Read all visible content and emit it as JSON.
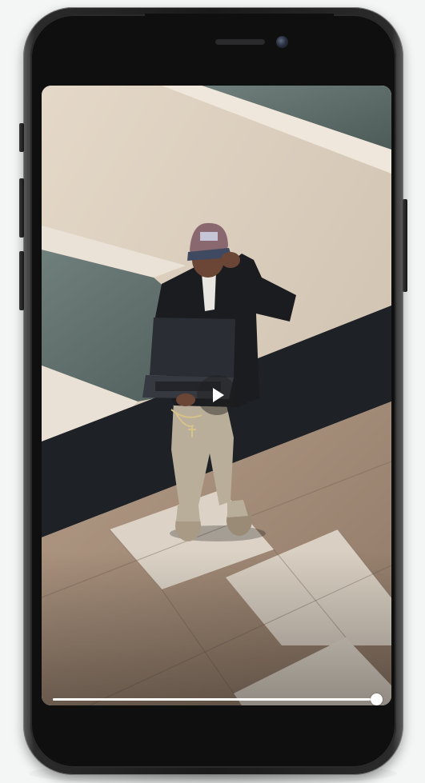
{
  "video": {
    "state": "paused",
    "progress": 1.0
  },
  "icons": {
    "play": "play-icon"
  },
  "colors": {
    "phone_body": "#1a1a1a",
    "progress": "#ffffff"
  }
}
